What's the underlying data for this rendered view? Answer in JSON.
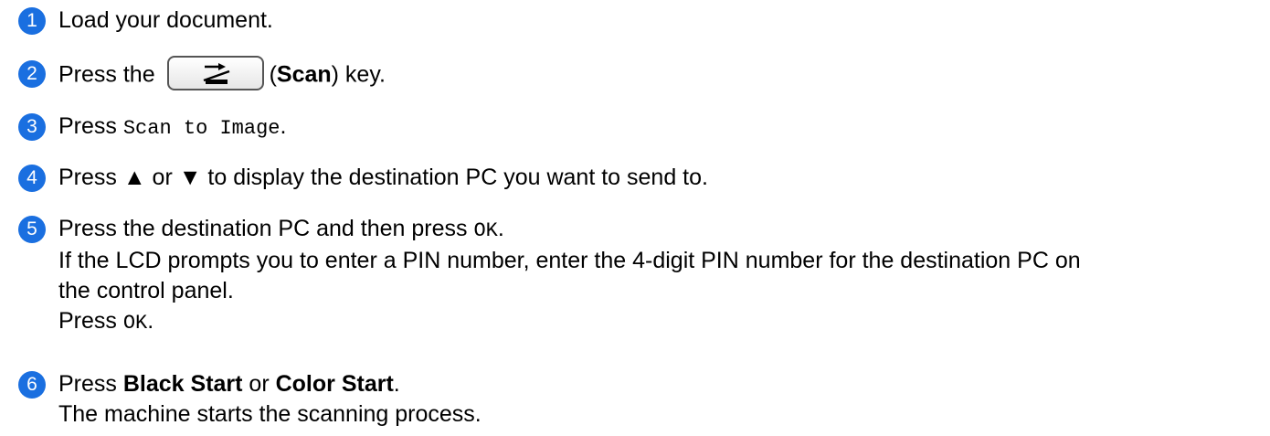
{
  "steps": [
    {
      "number": "1",
      "text": "Load your document."
    },
    {
      "number": "2",
      "pre": "Press the",
      "open_paren": "(",
      "key_name": "Scan",
      "post": ") key."
    },
    {
      "number": "3",
      "pre": "Press ",
      "mono": "Scan to Image",
      "post": "."
    },
    {
      "number": "4",
      "text": "Press ▲ or ▼ to display the destination PC you want to send to."
    },
    {
      "number": "5",
      "line1_pre": "Press the destination PC and then press ",
      "line1_mono": "OK",
      "line1_post": ".",
      "line2": "If the LCD prompts you to enter a PIN number, enter the 4-digit PIN number for the destination PC on",
      "line3": "the control panel.",
      "line4_pre": "Press ",
      "line4_mono": "OK",
      "line4_post": "."
    },
    {
      "number": "6",
      "pre": "Press ",
      "bold1": "Black Start",
      "mid": " or ",
      "bold2": "Color Start",
      "post": ".",
      "line2": "The machine starts the scanning process."
    }
  ],
  "colors": {
    "step_badge": "#1a6fe0"
  }
}
